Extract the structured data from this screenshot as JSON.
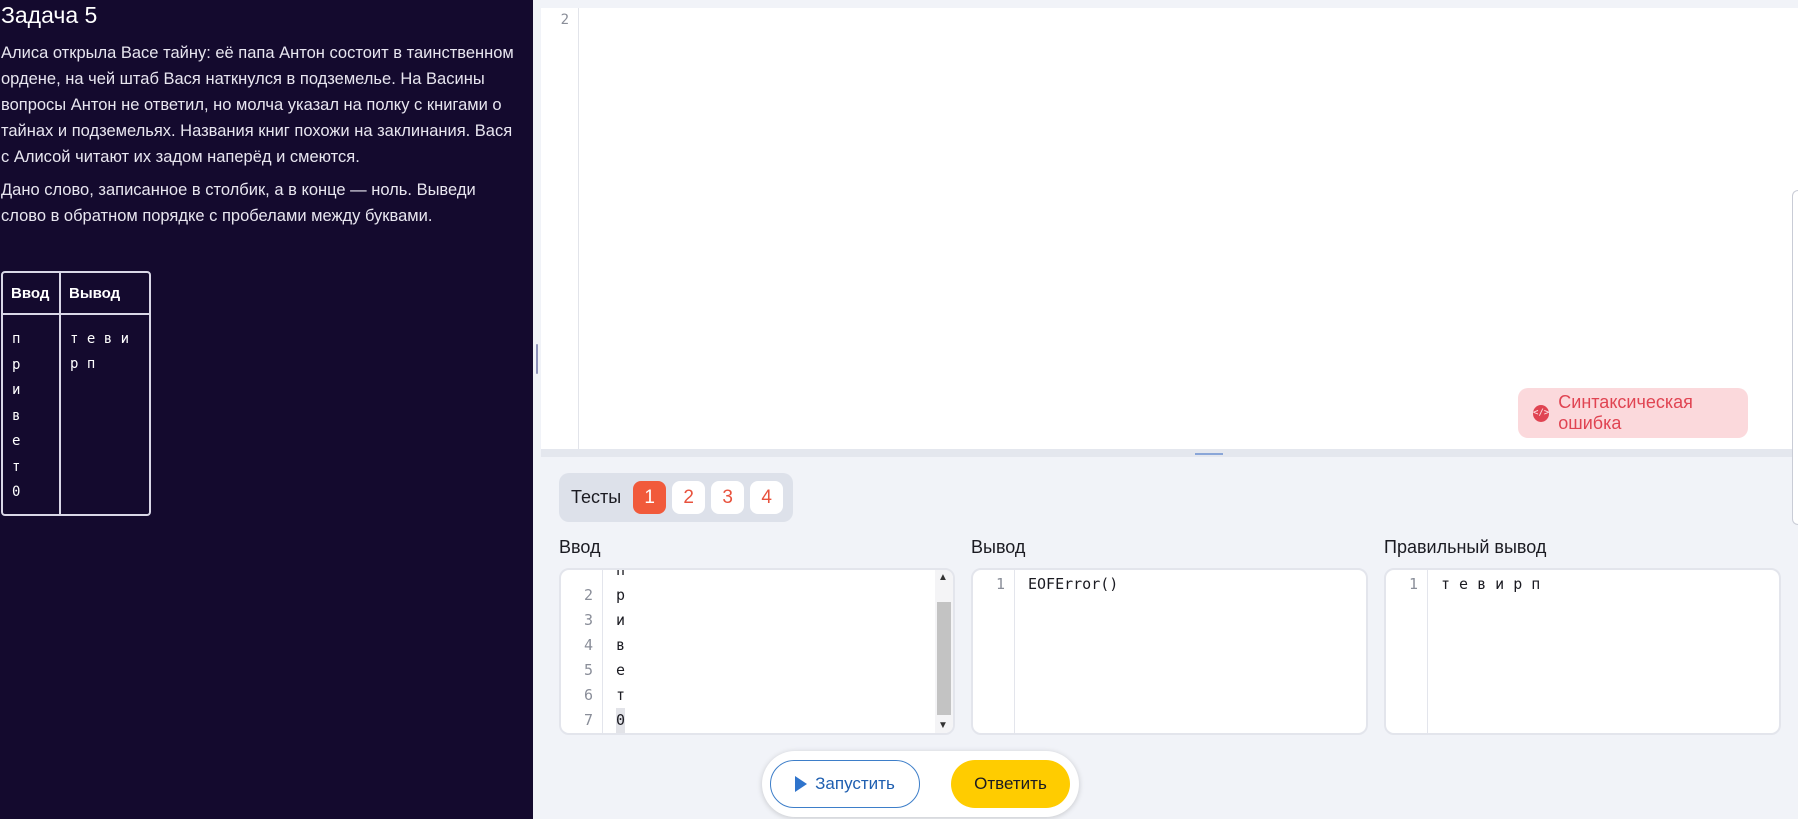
{
  "task": {
    "title": "Задача 5",
    "paragraph1": "Алиса открыла Васе тайну: её папа Антон состоит в таинственном ордене, на чей штаб Вася наткнулся в подземелье. На Васины вопросы Антон не ответил, но молча указал на полку с книгами о тайнах и подземельях. Названия книг похожи на заклинания. Вася с Алисой читают их задом наперёд и смеются.",
    "paragraph2": "Дано слово, записанное в столбик, а в конце — ноль. Выведи слово в обратном порядке с пробелами между буквами.",
    "example": {
      "header_input": "Ввод",
      "header_output": "Вывод",
      "input_lines": [
        "п",
        "р",
        "и",
        "в",
        "е",
        "т",
        "0"
      ],
      "output": "т е в и р п"
    }
  },
  "editor": {
    "visible_line_number": "2",
    "error_badge": "Синтаксическая ошибка",
    "error_icon": "code-icon"
  },
  "tests": {
    "label": "Тесты",
    "items": [
      "1",
      "2",
      "3",
      "4"
    ],
    "active": "1"
  },
  "panels": {
    "input_label": "Ввод",
    "output_label": "Вывод",
    "expected_label": "Правильный вывод",
    "input_rows": [
      {
        "n": "2",
        "t": "р"
      },
      {
        "n": "3",
        "t": "и"
      },
      {
        "n": "4",
        "t": "в"
      },
      {
        "n": "5",
        "t": "е"
      },
      {
        "n": "6",
        "t": "т"
      },
      {
        "n": "7",
        "t": "0"
      }
    ],
    "output_rows": [
      {
        "n": "1",
        "t": "EOFError()"
      }
    ],
    "expected_rows": [
      {
        "n": "1",
        "t": "т е в и р п"
      }
    ]
  },
  "actions": {
    "run_label": "Запустить",
    "submit_label": "Ответить",
    "accent_yellow": "#ffcc00",
    "accent_red": "#f15a3b"
  }
}
